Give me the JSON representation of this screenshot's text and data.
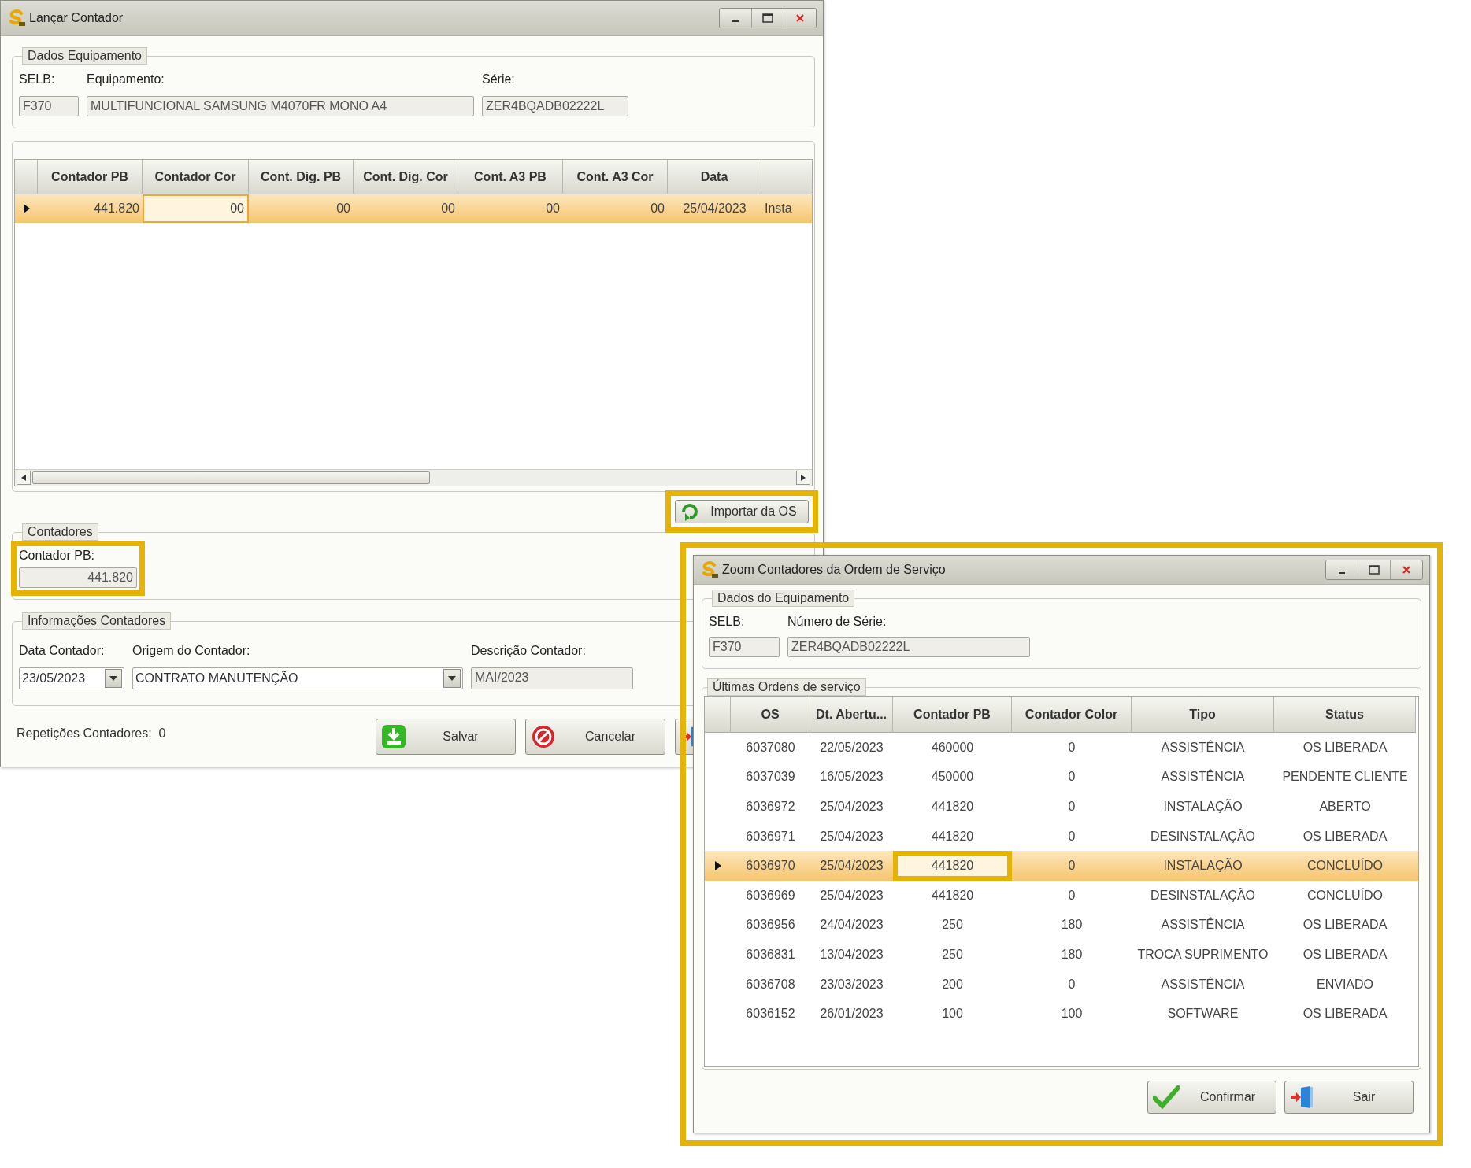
{
  "main_window": {
    "title": "Lançar Contador",
    "equipment": {
      "legend": "Dados Equipamento",
      "fields": [
        {
          "label": "SELB:",
          "value": "F370"
        },
        {
          "label": "Equipamento:",
          "value": "MULTIFUNCIONAL SAMSUNG M4070FR MONO A4"
        },
        {
          "label": "Série:",
          "value": "ZER4BQADB02222L"
        }
      ]
    },
    "grid": {
      "columns": [
        "Contador PB",
        "Contador Cor",
        "Cont. Dig. PB",
        "Cont. Dig. Cor",
        "Cont. A3 PB",
        "Cont. A3 Cor",
        "Data"
      ],
      "rows": [
        {
          "selected": true,
          "cells": [
            "441.820",
            "00",
            "00",
            "00",
            "00",
            "00",
            "25/04/2023",
            "Insta"
          ],
          "focus": [
            false,
            true,
            false,
            false,
            false,
            false,
            false,
            false
          ]
        }
      ]
    },
    "import_button": {
      "label": "Importar da OS",
      "highlighted": true
    },
    "counters": {
      "legend": "Contadores",
      "label": "Contador PB:",
      "value": "441.820",
      "highlighted": true
    },
    "info": {
      "legend": "Informações Contadores",
      "fields": [
        {
          "kind": "combo",
          "label": "Data Contador:",
          "value": "23/05/2023"
        },
        {
          "kind": "combo",
          "label": "Origem do Contador:",
          "value": "CONTRATO MANUTENÇÃO"
        },
        {
          "kind": "text",
          "label": "Descrição Contador:",
          "value": "MAI/2023"
        }
      ]
    },
    "repetitions": {
      "label": "Repetições Contadores:",
      "value": "0"
    },
    "buttons": [
      {
        "kind": "save",
        "label": "Salvar"
      },
      {
        "kind": "cancel",
        "label": "Cancelar"
      },
      {
        "kind": "exit"
      }
    ]
  },
  "dialog": {
    "title": "Zoom Contadores da Ordem de Serviço",
    "highlighted": true,
    "equipment": {
      "legend": "Dados do Equipamento",
      "fields": [
        {
          "label": "SELB:",
          "value": "F370"
        },
        {
          "label": "Número de Série:",
          "value": "ZER4BQADB02222L"
        }
      ]
    },
    "orders": {
      "legend": "Últimas Ordens de serviço",
      "columns": [
        "OS",
        "Dt. Abertu...",
        "Contador PB",
        "Contador Color",
        "Tipo",
        "Status"
      ],
      "rows": [
        {
          "selected": false,
          "cells": [
            "6037080",
            "22/05/2023",
            "460000",
            "0",
            "ASSISTÊNCIA",
            "OS LIBERADA"
          ],
          "focus": [
            false,
            false,
            false,
            false,
            false,
            false
          ]
        },
        {
          "selected": false,
          "cells": [
            "6037039",
            "16/05/2023",
            "450000",
            "0",
            "ASSISTÊNCIA",
            "PENDENTE CLIENTE"
          ],
          "focus": [
            false,
            false,
            false,
            false,
            false,
            false
          ]
        },
        {
          "selected": false,
          "cells": [
            "6036972",
            "25/04/2023",
            "441820",
            "0",
            "INSTALAÇÃO",
            "ABERTO"
          ],
          "focus": [
            false,
            false,
            false,
            false,
            false,
            false
          ]
        },
        {
          "selected": false,
          "cells": [
            "6036971",
            "25/04/2023",
            "441820",
            "0",
            "DESINSTALAÇÃO",
            "OS LIBERADA"
          ],
          "focus": [
            false,
            false,
            false,
            false,
            false,
            false
          ]
        },
        {
          "selected": true,
          "cells": [
            "6036970",
            "25/04/2023",
            "441820",
            "0",
            "INSTALAÇÃO",
            "CONCLUÍDO"
          ],
          "focus": [
            false,
            false,
            true,
            false,
            false,
            false
          ]
        },
        {
          "selected": false,
          "cells": [
            "6036969",
            "25/04/2023",
            "441820",
            "0",
            "DESINSTALAÇÃO",
            "CONCLUÍDO"
          ],
          "focus": [
            false,
            false,
            false,
            false,
            false,
            false
          ]
        },
        {
          "selected": false,
          "cells": [
            "6036956",
            "24/04/2023",
            "250",
            "180",
            "ASSISTÊNCIA",
            "OS LIBERADA"
          ],
          "focus": [
            false,
            false,
            false,
            false,
            false,
            false
          ]
        },
        {
          "selected": false,
          "cells": [
            "6036831",
            "13/04/2023",
            "250",
            "180",
            "TROCA SUPRIMENTO",
            "OS LIBERADA"
          ],
          "focus": [
            false,
            false,
            false,
            false,
            false,
            false
          ]
        },
        {
          "selected": false,
          "cells": [
            "6036708",
            "23/03/2023",
            "200",
            "0",
            "ASSISTÊNCIA",
            "ENVIADO"
          ],
          "focus": [
            false,
            false,
            false,
            false,
            false,
            false
          ]
        },
        {
          "selected": false,
          "cells": [
            "6036152",
            "26/01/2023",
            "100",
            "100",
            "SOFTWARE",
            "OS LIBERADA"
          ],
          "focus": [
            false,
            false,
            false,
            false,
            false,
            false
          ]
        }
      ]
    },
    "buttons": [
      {
        "kind": "confirm",
        "label": "Confirmar"
      },
      {
        "kind": "exit",
        "label": "Sair"
      }
    ]
  }
}
